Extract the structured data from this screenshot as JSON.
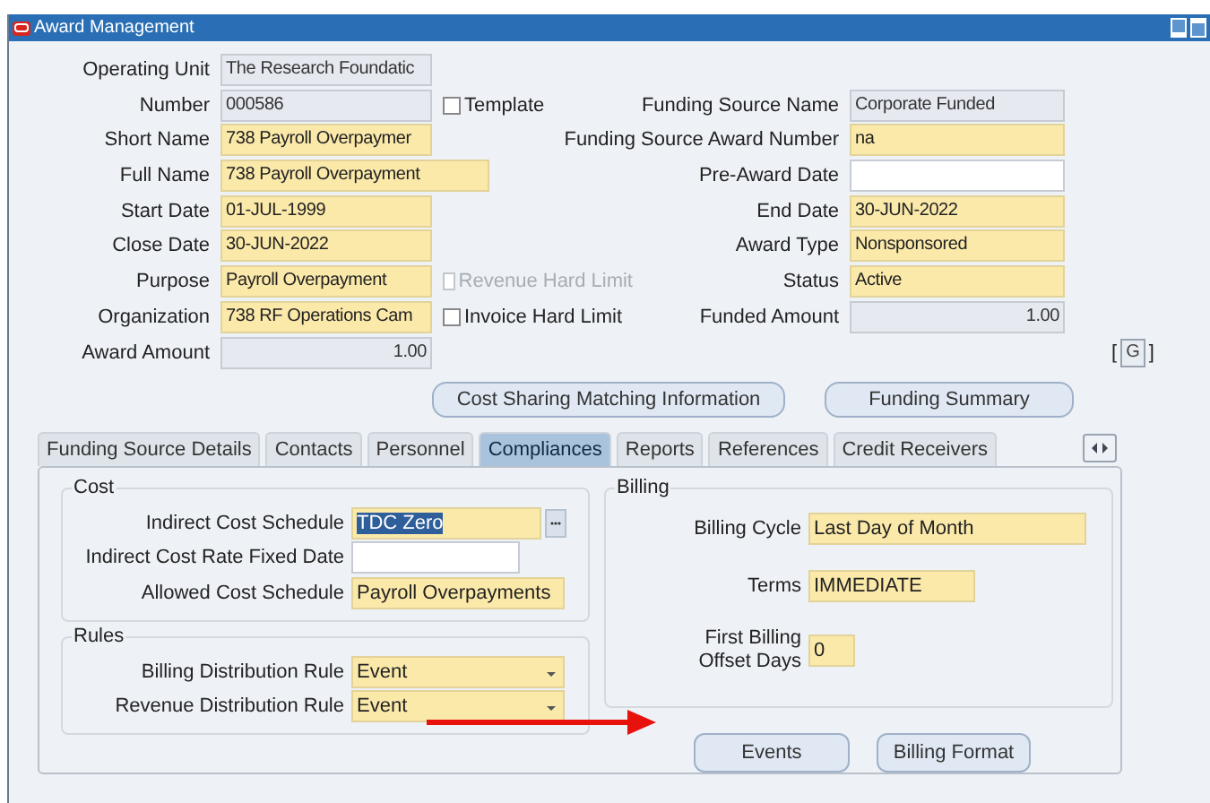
{
  "window": {
    "title": "Award Management"
  },
  "header": {
    "left_fields": [
      {
        "label": "Operating Unit",
        "value": "The Research Foundatic",
        "kind": "readonly"
      },
      {
        "label": "Number",
        "value": "000586",
        "kind": "readonly"
      },
      {
        "label": "Short Name",
        "value": "738 Payroll Overpaymer",
        "kind": "required"
      },
      {
        "label": "Full Name",
        "value": "738 Payroll Overpayment",
        "kind": "required",
        "wide": true
      },
      {
        "label": "Start Date",
        "value": "01-JUL-1999",
        "kind": "required"
      },
      {
        "label": "Close Date",
        "value": "30-JUN-2022",
        "kind": "required"
      },
      {
        "label": "Purpose",
        "value": "Payroll Overpayment",
        "kind": "required"
      },
      {
        "label": "Organization",
        "value": "738 RF Operations Cam",
        "kind": "required"
      },
      {
        "label": "Award Amount",
        "value": "1.00",
        "kind": "readonly",
        "right_aligned": true
      }
    ],
    "checkboxes": [
      {
        "label": "Template",
        "checked": false,
        "disabled": false
      },
      {
        "label": "Revenue Hard Limit",
        "checked": false,
        "disabled": true
      },
      {
        "label": "Invoice Hard Limit",
        "checked": false,
        "disabled": false
      }
    ],
    "right_fields": [
      {
        "label": "Funding Source Name",
        "value": "Corporate Funded",
        "kind": "readonly"
      },
      {
        "label": "Funding Source Award Number",
        "value": "na",
        "kind": "required"
      },
      {
        "label": "Pre-Award Date",
        "kind": "optional"
      },
      {
        "label": "End Date",
        "value": "30-JUN-2022",
        "kind": "required"
      },
      {
        "label": "Award Type",
        "value": "Nonsponsored",
        "kind": "required"
      },
      {
        "label": "Status",
        "value": "Active",
        "kind": "required"
      },
      {
        "label": "Funded Amount",
        "value": "1.00",
        "kind": "readonly",
        "right_aligned": true
      }
    ],
    "go": {
      "open": "[",
      "button": "G",
      "close": "]"
    }
  },
  "actions": [
    "Cost Sharing Matching Information",
    "Funding Summary"
  ],
  "tabs": [
    {
      "label": "Funding Source Details",
      "selected": false
    },
    {
      "label": "Contacts",
      "selected": false
    },
    {
      "label": "Personnel",
      "selected": false
    },
    {
      "label": "Compliances",
      "selected": true
    },
    {
      "label": "Reports",
      "selected": false
    },
    {
      "label": "References",
      "selected": false
    },
    {
      "label": "Credit Receivers",
      "selected": false
    }
  ],
  "cost": {
    "title": "Cost",
    "fields": [
      {
        "label": "Indirect Cost Schedule",
        "value": "TDC Zero",
        "kind": "lov",
        "text_selected": true
      },
      {
        "label": "Indirect Cost Rate Fixed Date",
        "kind": "optional"
      },
      {
        "label": "Allowed Cost Schedule",
        "value": "Payroll Overpayments",
        "kind": "required"
      }
    ]
  },
  "rules": {
    "title": "Rules",
    "fields": [
      {
        "label": "Billing Distribution Rule",
        "value": "Event",
        "kind": "select"
      },
      {
        "label": "Revenue Distribution Rule",
        "value": "Event",
        "kind": "select"
      }
    ]
  },
  "billing": {
    "title": "Billing",
    "fields": [
      {
        "label": "Billing Cycle",
        "value": "Last Day of Month"
      },
      {
        "label": "Terms",
        "value": "IMMEDIATE"
      },
      {
        "label": "First Billing Offset Days",
        "value": "0"
      }
    ]
  },
  "billing_buttons": [
    "Events",
    "Billing Format"
  ]
}
